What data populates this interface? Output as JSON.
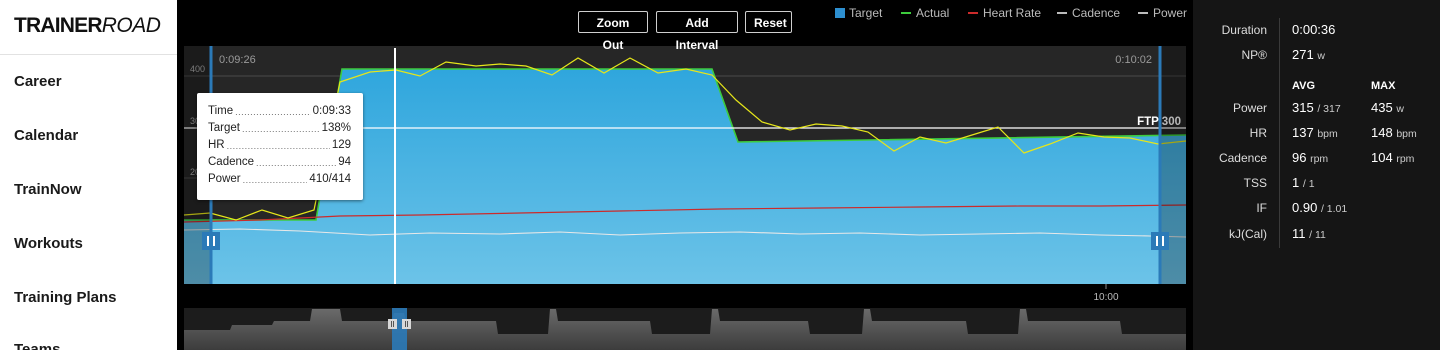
{
  "sidebar": {
    "logo": {
      "bold": "TRAINER",
      "light": "ROAD"
    },
    "nav": [
      {
        "label": "Career"
      },
      {
        "label": "Calendar"
      },
      {
        "label": "TrainNow"
      },
      {
        "label": "Workouts"
      },
      {
        "label": "Training Plans"
      },
      {
        "label": "Teams"
      }
    ]
  },
  "toolbar": {
    "zoom_out": "Zoom Out",
    "add_interval": "Add Interval",
    "reset": "Reset"
  },
  "legend": [
    {
      "label": "Target",
      "color": "#2d8fd0",
      "icon": "square-swatch"
    },
    {
      "label": "Actual",
      "color": "#3dcc3d",
      "icon": "line-swatch"
    },
    {
      "label": "Heart Rate",
      "color": "#cc2b2b",
      "icon": "line-swatch"
    },
    {
      "label": "Cadence",
      "color": "#bbbbbb",
      "icon": "line-swatch"
    },
    {
      "label": "Power",
      "color": "#bbbbbb",
      "icon": "line-swatch"
    }
  ],
  "chart": {
    "range_start": "0:09:26",
    "range_end": "0:10:02",
    "y_tick_400": "400",
    "y_tick_300": "300",
    "y_tick_200": "200",
    "ftp_label": "FTP 300",
    "x_tick": "10:00",
    "colors": {
      "target_top": "#2fa6dd",
      "target_bottom": "#6cc3e8",
      "actual": "#3dcc3d",
      "heart_rate": "#cc2b2b",
      "cadence": "#e6e6e6",
      "power": "#e6e61a",
      "marker": "#2b7ab8"
    }
  },
  "tooltip": {
    "rows": [
      {
        "label": "Time",
        "value": "0:09:33"
      },
      {
        "label": "Target",
        "value": "138%"
      },
      {
        "label": "HR",
        "value": "129"
      },
      {
        "label": "Cadence",
        "value": "94"
      },
      {
        "label": "Power",
        "value": "410/414"
      }
    ]
  },
  "stats": {
    "duration_label": "Duration",
    "duration_value": "0:00:36",
    "np_label": "NP®",
    "np_value": "271",
    "np_unit": "w",
    "avg_header": "AVG",
    "max_header": "MAX",
    "rows": [
      {
        "label": "Power",
        "avg": "315",
        "avg_sub": "/ 317",
        "max": "435",
        "max_unit": "w"
      },
      {
        "label": "HR",
        "avg": "137",
        "avg_sub": "bpm",
        "max": "148",
        "max_unit": "bpm"
      },
      {
        "label": "Cadence",
        "avg": "96",
        "avg_sub": "rpm",
        "max": "104",
        "max_unit": "rpm"
      },
      {
        "label": "TSS",
        "avg": "1",
        "avg_sub": "/ 1",
        "max": "",
        "max_unit": ""
      },
      {
        "label": "IF",
        "avg": "0.90",
        "avg_sub": "/ 1.01",
        "max": "",
        "max_unit": ""
      },
      {
        "label": "kJ(Cal)",
        "avg": "11",
        "avg_sub": "/ 11",
        "max": "",
        "max_unit": ""
      }
    ]
  }
}
